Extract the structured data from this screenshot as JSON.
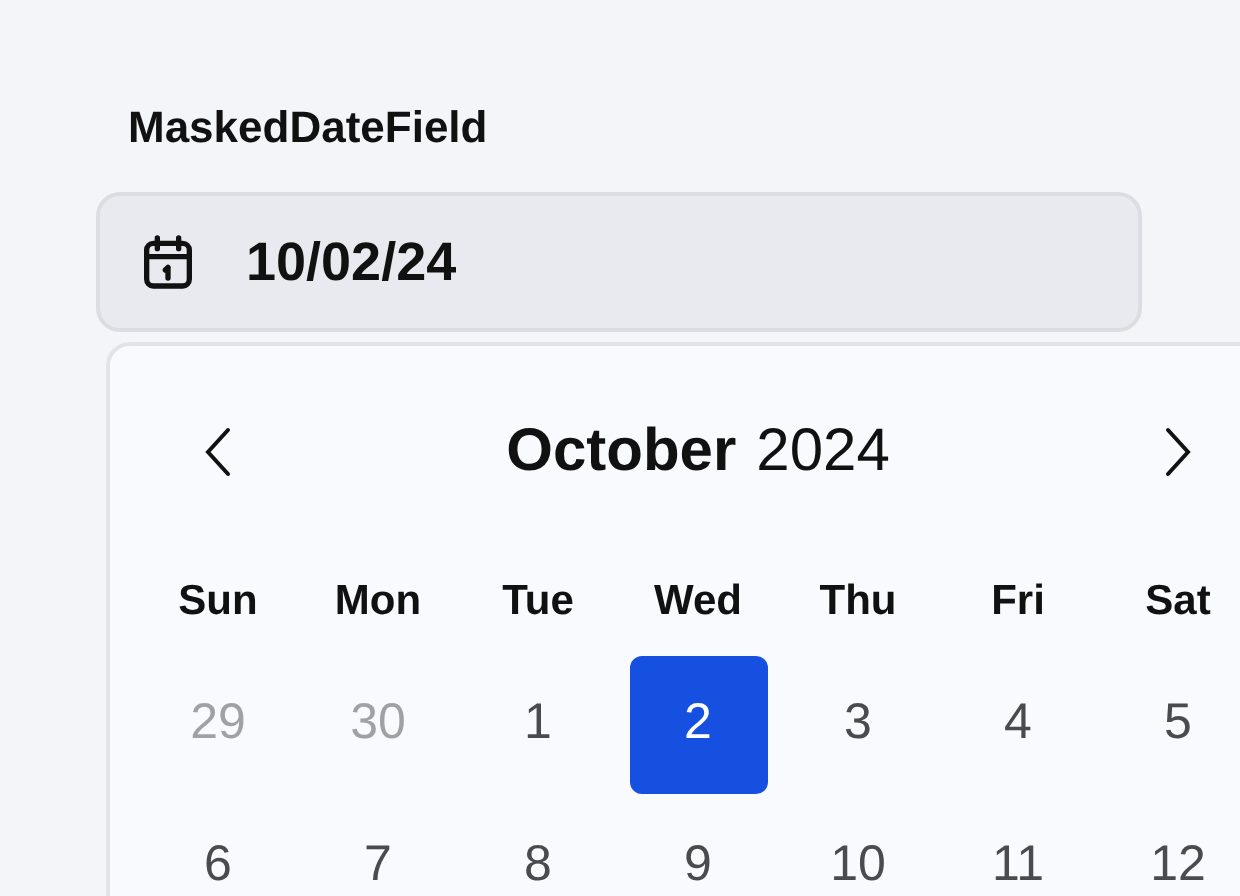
{
  "label": "MaskedDateField",
  "field": {
    "value": "10/02/24"
  },
  "calendar": {
    "month": "October",
    "year": "2024",
    "weekdays": [
      "Sun",
      "Mon",
      "Tue",
      "Wed",
      "Thu",
      "Fri",
      "Sat"
    ],
    "weeks": [
      [
        {
          "day": "29",
          "outside": true,
          "selected": false
        },
        {
          "day": "30",
          "outside": true,
          "selected": false
        },
        {
          "day": "1",
          "outside": false,
          "selected": false
        },
        {
          "day": "2",
          "outside": false,
          "selected": true
        },
        {
          "day": "3",
          "outside": false,
          "selected": false
        },
        {
          "day": "4",
          "outside": false,
          "selected": false
        },
        {
          "day": "5",
          "outside": false,
          "selected": false
        }
      ],
      [
        {
          "day": "6",
          "outside": false,
          "selected": false
        },
        {
          "day": "7",
          "outside": false,
          "selected": false
        },
        {
          "day": "8",
          "outside": false,
          "selected": false
        },
        {
          "day": "9",
          "outside": false,
          "selected": false
        },
        {
          "day": "10",
          "outside": false,
          "selected": false
        },
        {
          "day": "11",
          "outside": false,
          "selected": false
        },
        {
          "day": "12",
          "outside": false,
          "selected": false
        }
      ]
    ]
  }
}
